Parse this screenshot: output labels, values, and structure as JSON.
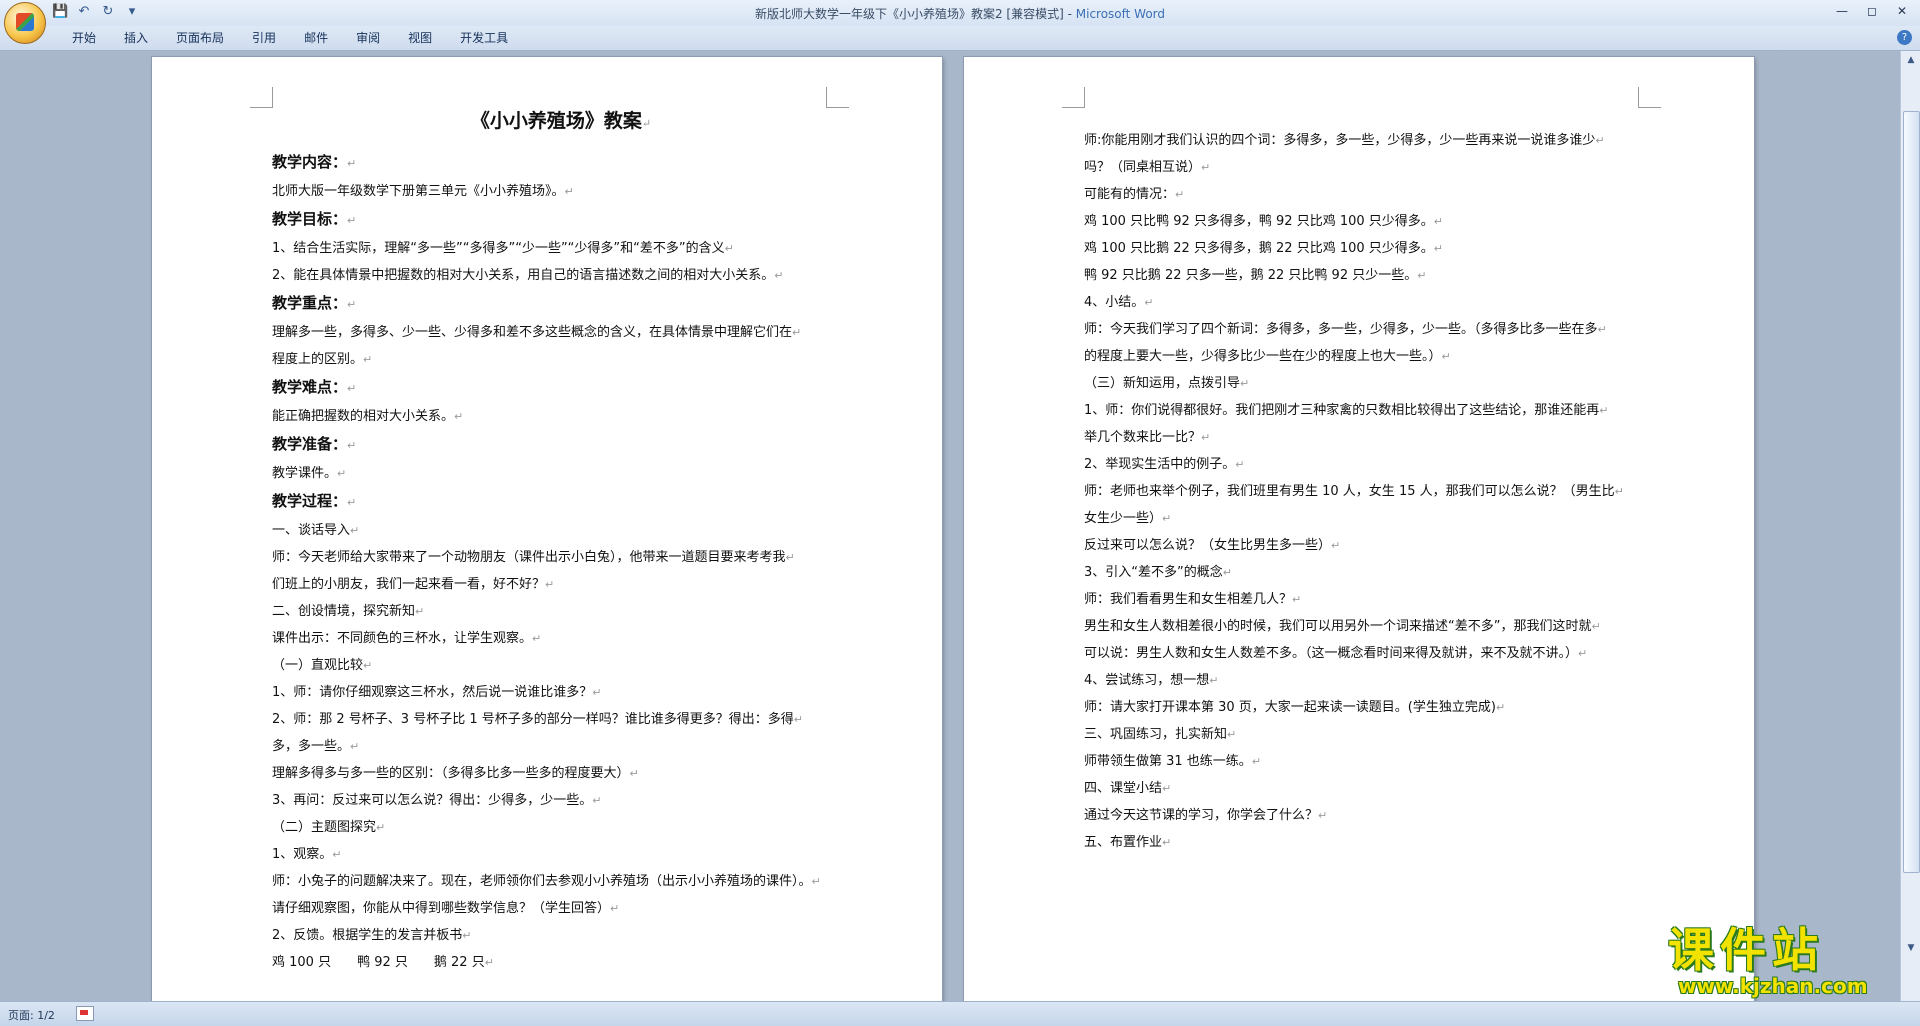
{
  "window": {
    "title": "新版北师大数学一年级下《小小养殖场》教案2 [兼容模式] - ",
    "app_name": "Microsoft Word"
  },
  "quick_access": {
    "save_icon": "save-icon",
    "undo_icon": "undo-icon",
    "redo_icon": "redo-icon",
    "customize_icon": "dropdown-icon"
  },
  "ribbon": {
    "tabs": [
      "开始",
      "插入",
      "页面布局",
      "引用",
      "邮件",
      "审阅",
      "视图",
      "开发工具"
    ]
  },
  "page1": {
    "title": "《小小养殖场》教案",
    "lines": [
      {
        "text": "教学内容：",
        "heading": true
      },
      {
        "text": "北师大版一年级数学下册第三单元《小小养殖场》。",
        "heading": false
      },
      {
        "text": "教学目标：",
        "heading": true
      },
      {
        "text": "1、结合生活实际，理解“多一些”“多得多”“少一些”“少得多”和“差不多”的含义",
        "heading": false
      },
      {
        "text": "2、能在具体情景中把握数的相对大小关系，用自己的语言描述数之间的相对大小关系。",
        "heading": false
      },
      {
        "text": "教学重点：",
        "heading": true
      },
      {
        "text": "理解多一些，多得多、少一些、少得多和差不多这些概念的含义，在具体情景中理解它们在",
        "heading": false
      },
      {
        "text": "程度上的区别。",
        "heading": false
      },
      {
        "text": "教学难点：",
        "heading": true
      },
      {
        "text": "能正确把握数的相对大小关系。",
        "heading": false
      },
      {
        "text": "教学准备：",
        "heading": true
      },
      {
        "text": "教学课件。",
        "heading": false
      },
      {
        "text": "教学过程：",
        "heading": true
      },
      {
        "text": "一、谈话导入",
        "heading": false
      },
      {
        "text": "师：今天老师给大家带来了一个动物朋友（课件出示小白兔），他带来一道题目要来考考我",
        "heading": false
      },
      {
        "text": "们班上的小朋友，我们一起来看一看，好不好？",
        "heading": false
      },
      {
        "text": "二、创设情境，探究新知",
        "heading": false
      },
      {
        "text": "课件出示：不同颜色的三杯水，让学生观察。",
        "heading": false
      },
      {
        "text": "（一）直观比较",
        "heading": false
      },
      {
        "text": "1、师：请你仔细观察这三杯水，然后说一说谁比谁多？",
        "heading": false
      },
      {
        "text": "2、师：那 2 号杯子、3 号杯子比 1 号杯子多的部分一样吗？谁比谁多得更多？得出：多得",
        "heading": false
      },
      {
        "text": "多，多一些。",
        "heading": false
      },
      {
        "text": "理解多得多与多一些的区别：（多得多比多一些多的程度要大）",
        "heading": false
      },
      {
        "text": "3、再问：反过来可以怎么说？得出：少得多，少一些。",
        "heading": false
      },
      {
        "text": "（二）主题图探究",
        "heading": false
      },
      {
        "text": "1、观察。",
        "heading": false
      },
      {
        "text": "师：小兔子的问题解决来了。现在，老师领你们去参观小小养殖场（出示小小养殖场的课件）。",
        "heading": false
      },
      {
        "text": "请仔细观察图，你能从中得到哪些数学信息？（学生回答）",
        "heading": false
      },
      {
        "text": "2、反馈。根据学生的发言并板书",
        "heading": false
      },
      {
        "text": "鸡 100 只　　鸭 92 只　　鹅 22 只",
        "heading": false
      }
    ]
  },
  "page2": {
    "lines": [
      "师:你能用刚才我们认识的四个词：多得多，多一些，少得多，少一些再来说一说谁多谁少",
      "吗？（同桌相互说）",
      "可能有的情况：",
      "鸡 100 只比鸭 92 只多得多，鸭 92 只比鸡 100 只少得多。",
      "鸡 100 只比鹅 22 只多得多，鹅 22 只比鸡 100 只少得多。",
      "鸭 92 只比鹅 22 只多一些，鹅 22 只比鸭 92 只少一些。",
      "4、小结。",
      "师：今天我们学习了四个新词：多得多，多一些，少得多，少一些。（多得多比多一些在多",
      "的程度上要大一些，少得多比少一些在少的程度上也大一些。）",
      "（三）新知运用，点拨引导",
      "1、师：你们说得都很好。我们把刚才三种家禽的只数相比较得出了这些结论，那谁还能再",
      "举几个数来比一比？",
      "2、举现实生活中的例子。",
      "师：老师也来举个例子，我们班里有男生 10 人，女生 15 人，那我们可以怎么说？（男生比",
      "女生少一些）",
      "反过来可以怎么说？（女生比男生多一些）",
      "3、引入“差不多”的概念",
      "师：我们看看男生和女生相差几人？",
      "男生和女生人数相差很小的时候，我们可以用另外一个词来描述“差不多”，那我们这时就",
      "可以说：男生人数和女生人数差不多。（这一概念看时间来得及就讲，来不及就不讲。）",
      "4、尝试练习，想一想",
      "师：请大家打开课本第 30 页，大家一起来读一读题目。(学生独立完成)",
      "三、巩固练习，扎实新知",
      "师带领生做第 31 也练一练。",
      "四、课堂小结",
      "通过今天这节课的学习，你学会了什么？",
      "五、布置作业"
    ]
  },
  "status": {
    "page": "页面: 1/2"
  },
  "watermark": {
    "text": "课件站",
    "url": "www.kjzhan.com"
  },
  "paragraph_mark": "↵"
}
